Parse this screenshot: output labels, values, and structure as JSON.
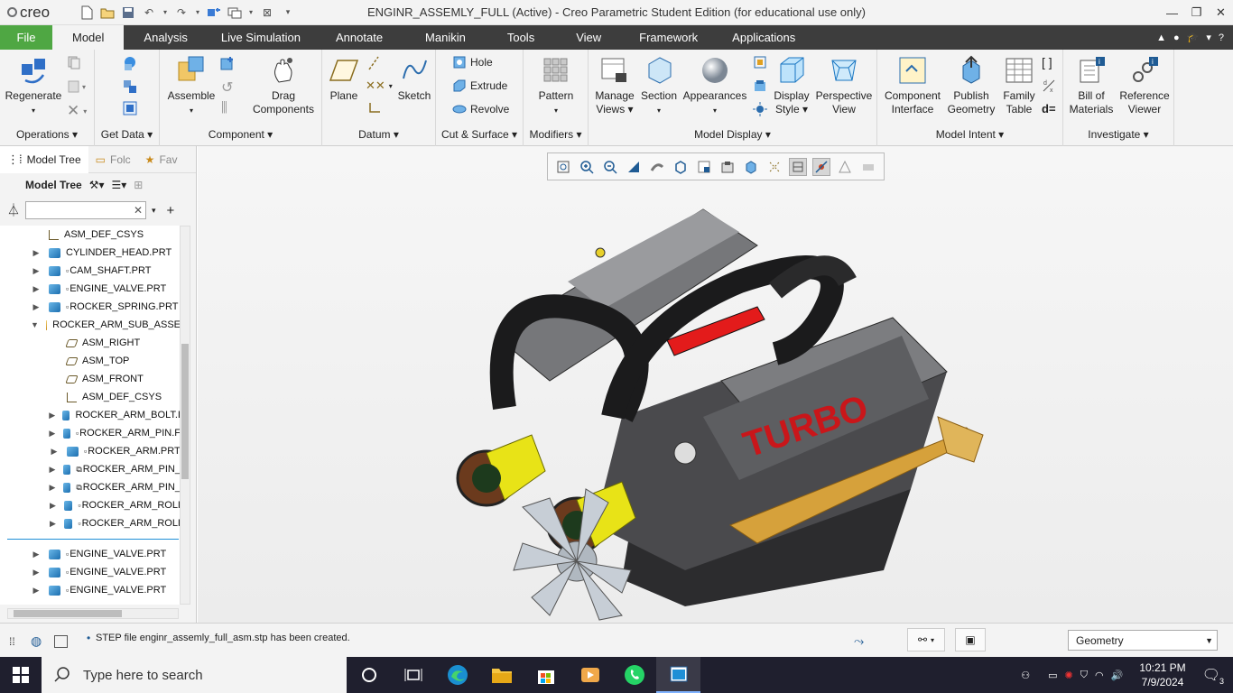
{
  "app": {
    "logo": "creo",
    "window_title": "ENGINR_ASSEMLY_FULL (Active) - Creo Parametric Student Edition (for educational use only)"
  },
  "tabs": [
    {
      "label": "File"
    },
    {
      "label": "Model"
    },
    {
      "label": "Analysis"
    },
    {
      "label": "Live Simulation"
    },
    {
      "label": "Annotate"
    },
    {
      "label": "Manikin"
    },
    {
      "label": "Tools"
    },
    {
      "label": "View"
    },
    {
      "label": "Framework"
    },
    {
      "label": "Applications"
    }
  ],
  "ribbon": {
    "operations": {
      "label": "Operations",
      "regenerate": "Regenerate"
    },
    "get_data": {
      "label": "Get Data"
    },
    "component": {
      "label": "Component",
      "assemble": "Assemble",
      "drag": "Drag Components"
    },
    "datum": {
      "label": "Datum",
      "plane": "Plane",
      "sketch": "Sketch"
    },
    "cut_surface": {
      "label": "Cut & Surface",
      "hole": "Hole",
      "extrude": "Extrude",
      "revolve": "Revolve"
    },
    "modifiers": {
      "label": "Modifiers",
      "pattern": "Pattern"
    },
    "model_display": {
      "label": "Model Display",
      "manage_views": "Manage Views",
      "section": "Section",
      "appearances": "Appearances",
      "display_style": "Display Style",
      "perspective": "Perspective View"
    },
    "model_intent": {
      "label": "Model Intent",
      "component_interface": "Component Interface",
      "publish_geometry": "Publish Geometry",
      "family_table": "Family Table"
    },
    "investigate": {
      "label": "Investigate",
      "bom": "Bill of Materials",
      "reference_viewer": "Reference Viewer"
    }
  },
  "left_panel": {
    "tabs": [
      {
        "label": "Model Tree"
      },
      {
        "label": "Folc"
      },
      {
        "label": "Fav"
      }
    ],
    "toolbar_title": "Model Tree",
    "filter_placeholder": ""
  },
  "tree_rows": [
    {
      "label": "ASM_DEF_CSYS",
      "type": "csys",
      "indent": 1,
      "expand": ""
    },
    {
      "label": "CYLINDER_HEAD.PRT",
      "type": "prt",
      "indent": 1,
      "expand": "▶"
    },
    {
      "label": "CAM_SHAFT.PRT",
      "type": "prt",
      "indent": 1,
      "expand": "▶",
      "marker": "▫"
    },
    {
      "label": "ENGINE_VALVE.PRT",
      "type": "prt",
      "indent": 1,
      "expand": "▶",
      "marker": "▫"
    },
    {
      "label": "ROCKER_SPRING.PRT",
      "type": "prt",
      "indent": 1,
      "expand": "▶",
      "marker": "▫"
    },
    {
      "label": "ROCKER_ARM_SUB_ASSE",
      "type": "asm",
      "indent": 1,
      "expand": "▼"
    },
    {
      "label": "ASM_RIGHT",
      "type": "plane",
      "indent": 2,
      "expand": ""
    },
    {
      "label": "ASM_TOP",
      "type": "plane",
      "indent": 2,
      "expand": ""
    },
    {
      "label": "ASM_FRONT",
      "type": "plane",
      "indent": 2,
      "expand": ""
    },
    {
      "label": "ASM_DEF_CSYS",
      "type": "csys",
      "indent": 2,
      "expand": ""
    },
    {
      "label": "ROCKER_ARM_BOLT.I",
      "type": "prt",
      "indent": 2,
      "expand": "▶"
    },
    {
      "label": "ROCKER_ARM_PIN.F",
      "type": "prt",
      "indent": 2,
      "expand": "▶",
      "marker": "▫"
    },
    {
      "label": "ROCKER_ARM.PRT",
      "type": "prt",
      "indent": 2,
      "expand": "▶",
      "marker": "▫"
    },
    {
      "label": "ROCKER_ARM_PIN_",
      "type": "prt",
      "indent": 2,
      "expand": "▶",
      "marker": "⧉"
    },
    {
      "label": "ROCKER_ARM_PIN_",
      "type": "prt",
      "indent": 2,
      "expand": "▶",
      "marker": "⧉"
    },
    {
      "label": "ROCKER_ARM_ROLI",
      "type": "prt",
      "indent": 2,
      "expand": "▶",
      "marker": "▫"
    },
    {
      "label": "ROCKER_ARM_ROLI",
      "type": "prt",
      "indent": 2,
      "expand": "▶",
      "marker": "▫"
    },
    {
      "label": "ENGINE_VALVE.PRT",
      "type": "prt",
      "indent": 1,
      "expand": "▶",
      "marker": "▫"
    },
    {
      "label": "ENGINE_VALVE.PRT",
      "type": "prt",
      "indent": 1,
      "expand": "▶",
      "marker": "▫"
    },
    {
      "label": "ENGINE_VALVE.PRT",
      "type": "prt",
      "indent": 1,
      "expand": "▶",
      "marker": "▫"
    }
  ],
  "model": {
    "turbo_text": "TURBO"
  },
  "status": {
    "message": "STEP file enginr_assemly_full_asm.stp has been created.",
    "filter_value": "Geometry"
  },
  "taskbar": {
    "search_placeholder": "Type here to search",
    "time": "10:21 PM",
    "date": "7/9/2024",
    "notifications": "3"
  }
}
